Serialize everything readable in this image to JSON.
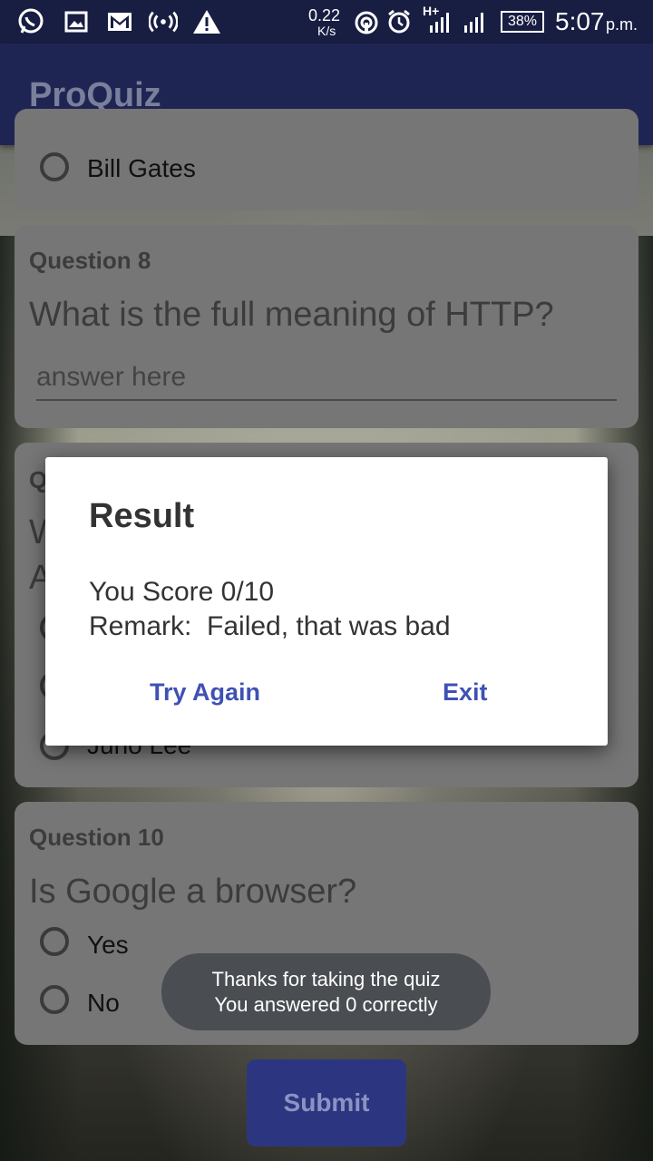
{
  "status_bar": {
    "speed_value": "0.22",
    "speed_unit": "K/s",
    "network_label": "H+",
    "battery": "38%",
    "time": "5:07",
    "ampm": "p.m."
  },
  "app": {
    "title": "ProQuiz"
  },
  "question7": {
    "visible_option": "Bill Gates"
  },
  "question8": {
    "label": "Question 8",
    "text": "What is the full meaning of HTTP?",
    "placeholder": "answer here"
  },
  "question9": {
    "label_partial": "Q",
    "text_partial_1": "W",
    "text_partial_2": "A",
    "visible_option_partial": "Juno Lee"
  },
  "question10": {
    "label": "Question 10",
    "text": "Is Google a browser?",
    "options": [
      "Yes",
      "No"
    ]
  },
  "dialog": {
    "title": "Result",
    "score_line": "You Score 0/10",
    "remark_line": "Remark:  Failed, that was bad",
    "try_again": "Try Again",
    "exit": "Exit"
  },
  "toast": {
    "line1": "Thanks for taking the quiz",
    "line2": "You answered 0 correctly"
  },
  "submit_label": "Submit",
  "colors": {
    "primary": "#1f2553",
    "status_bar": "#181d42",
    "accent": "#3f51b5",
    "card": "#767676"
  }
}
